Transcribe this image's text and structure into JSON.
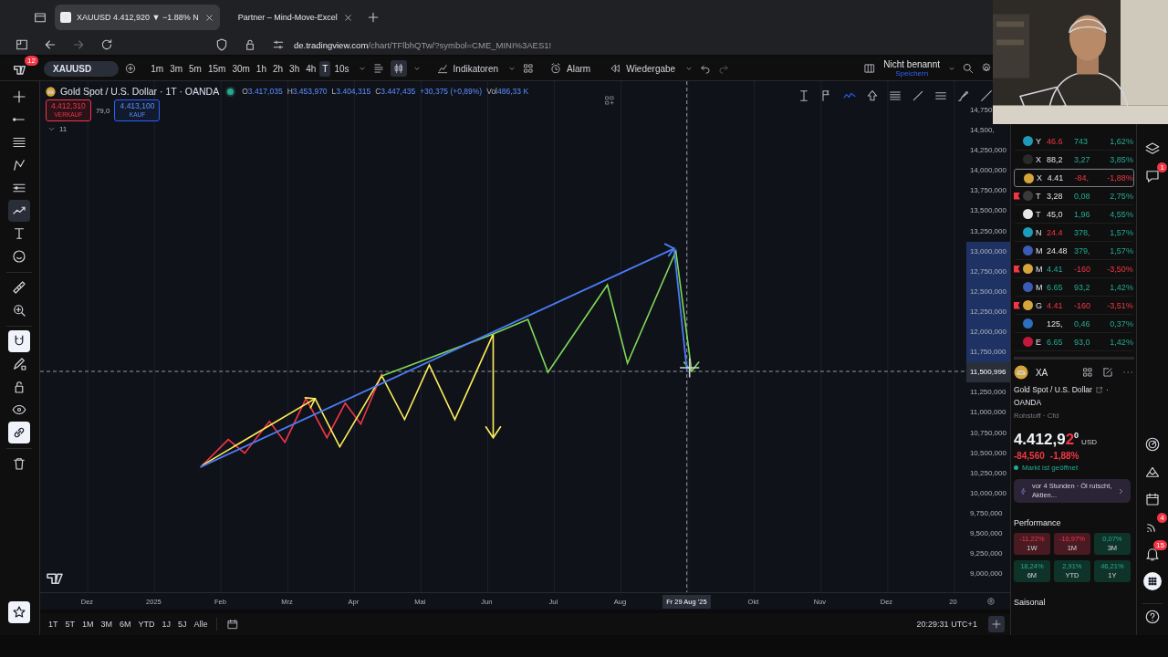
{
  "browser": {
    "tabs": [
      {
        "title": "XAUUSD 4.412,920 ▼ −1.88% N",
        "selected": true
      },
      {
        "title": "Partner – Mind-Move-Excel",
        "selected": false
      }
    ],
    "url_host": "de.tradingview.com",
    "url_path": "/chart/TFlbhQTw/?symbol=CME_MINI%3AES1!"
  },
  "toolbar": {
    "logo_badge": "12",
    "symbol": "XAUUSD",
    "intervals": [
      {
        "label": "1m",
        "selected": false
      },
      {
        "label": "3m",
        "selected": false
      },
      {
        "label": "5m",
        "selected": false
      },
      {
        "label": "15m",
        "selected": false
      },
      {
        "label": "30m",
        "selected": false
      },
      {
        "label": "1h",
        "selected": false
      },
      {
        "label": "2h",
        "selected": false
      },
      {
        "label": "3h",
        "selected": false
      },
      {
        "label": "4h",
        "selected": false
      },
      {
        "label": "T",
        "selected": true
      },
      {
        "label": "10s",
        "selected": false
      }
    ],
    "indicators": "Indikatoren",
    "alarm": "Alarm",
    "replay": "Wiedergabe",
    "layout_name": "Nicht benannt",
    "save": "Speichern"
  },
  "left_tools": [
    {
      "kind": "tool",
      "selected": false
    },
    {
      "kind": "tool",
      "selected": false
    },
    {
      "kind": "tool",
      "selected": false
    },
    {
      "kind": "tool",
      "selected": false
    },
    {
      "kind": "tool",
      "selected": false
    },
    {
      "kind": "tool",
      "selected": true
    },
    {
      "kind": "tool",
      "selected": false
    },
    {
      "kind": "tool",
      "selected": false
    },
    {
      "kind": "tool",
      "selected": false
    },
    {
      "kind": "tool",
      "selected": false
    },
    {
      "kind": "toggle",
      "on": true
    },
    {
      "kind": "toggle",
      "on": false
    },
    {
      "kind": "toggle",
      "on": false
    },
    {
      "kind": "toggle",
      "on": false
    },
    {
      "kind": "toggle",
      "on": true
    },
    {
      "kind": "tool",
      "selected": false
    }
  ],
  "favorites_on": true,
  "legend": {
    "title": "Gold Spot / U.S. Dollar · 1T · OANDA",
    "live": true,
    "ohlc": [
      {
        "label": "O",
        "value": "3.417,035"
      },
      {
        "label": "H",
        "value": "3.453,970"
      },
      {
        "label": "L",
        "value": "3.404,315"
      },
      {
        "label": "C",
        "value": "3.447,435"
      }
    ],
    "change": "+30,375 (+0,89%)",
    "volume_label": "Vol",
    "volume": "486,33 K",
    "sell": {
      "price": "4.412,310",
      "label": "VERKAUF"
    },
    "spread": "79,0",
    "buy": {
      "price": "4.413,100",
      "label": "KAUF"
    },
    "indicator_count": "11"
  },
  "y_axis": [
    {
      "label": "14,750,",
      "in_range": false,
      "current": false
    },
    {
      "label": "14,500,",
      "in_range": false,
      "current": false
    },
    {
      "label": "14,250,000",
      "in_range": false,
      "current": false
    },
    {
      "label": "14,000,000",
      "in_range": false,
      "current": false
    },
    {
      "label": "13,750,000",
      "in_range": false,
      "current": false
    },
    {
      "label": "13,500,000",
      "in_range": false,
      "current": false
    },
    {
      "label": "13,250,000",
      "in_range": false,
      "current": false
    },
    {
      "label": "13,000,000",
      "in_range": true,
      "current": false
    },
    {
      "label": "12,750,000",
      "in_range": true,
      "current": false
    },
    {
      "label": "12,500,000",
      "in_range": true,
      "current": false
    },
    {
      "label": "12,250,000",
      "in_range": true,
      "current": false
    },
    {
      "label": "12,000,000",
      "in_range": true,
      "current": false
    },
    {
      "label": "11,750,000",
      "in_range": true,
      "current": false
    },
    {
      "label": "11,500,996",
      "in_range": false,
      "current": true
    },
    {
      "label": "11,250,000",
      "in_range": false,
      "current": false
    },
    {
      "label": "11,000,000",
      "in_range": false,
      "current": false
    },
    {
      "label": "10,750,000",
      "in_range": false,
      "current": false
    },
    {
      "label": "10,500,000",
      "in_range": false,
      "current": false
    },
    {
      "label": "10,250,000",
      "in_range": false,
      "current": false
    },
    {
      "label": "10,000,000",
      "in_range": false,
      "current": false
    },
    {
      "label": "9,750,000",
      "in_range": false,
      "current": false
    },
    {
      "label": "9,500,000",
      "in_range": false,
      "current": false
    },
    {
      "label": "9,250,000",
      "in_range": false,
      "current": false
    },
    {
      "label": "9,000,000",
      "in_range": false,
      "current": false
    }
  ],
  "x_axis": [
    {
      "label": "Dez",
      "current": false
    },
    {
      "label": "2025",
      "current": false
    },
    {
      "label": "Feb",
      "current": false
    },
    {
      "label": "Mrz",
      "current": false
    },
    {
      "label": "Apr",
      "current": false
    },
    {
      "label": "Mai",
      "current": false
    },
    {
      "label": "Jun",
      "current": false
    },
    {
      "label": "Jul",
      "current": false
    },
    {
      "label": "Aug",
      "current": false
    },
    {
      "label": "Fr 29 Aug '25",
      "current": true
    },
    {
      "label": "Okt",
      "current": false
    },
    {
      "label": "Nov",
      "current": false
    },
    {
      "label": "Dez",
      "current": false
    },
    {
      "label": "20",
      "current": false
    }
  ],
  "ranges": [
    "1T",
    "5T",
    "1M",
    "3M",
    "6M",
    "YTD",
    "1J",
    "5J",
    "Alle"
  ],
  "clock": "20:29:31 UTC+1",
  "watchlist": [
    {
      "symbol": "Y",
      "last": "46.6",
      "last_up": false,
      "last_down": true,
      "change": "743",
      "pct": "1,62%",
      "negative": false,
      "color": "#1e9bb8",
      "flagged": false,
      "selected": false
    },
    {
      "symbol": "X",
      "last": "88,2",
      "last_up": false,
      "last_down": false,
      "change": "3,27",
      "pct": "3,85%",
      "negative": false,
      "color": "#2a2a2a",
      "flagged": false,
      "selected": false
    },
    {
      "symbol": "X",
      "last": "4.41",
      "last_up": false,
      "last_down": false,
      "change": "-84,",
      "pct": "-1,88%",
      "negative": true,
      "color": "#d4a53a",
      "flagged": false,
      "selected": true
    },
    {
      "symbol": "T",
      "last": "3,28",
      "last_up": false,
      "last_down": false,
      "change": "0,08",
      "pct": "2,75%",
      "negative": false,
      "color": "#3a3a3a",
      "flagged": true,
      "selected": false
    },
    {
      "symbol": "T",
      "last": "45,0",
      "last_up": false,
      "last_down": false,
      "change": "1,96",
      "pct": "4,55%",
      "negative": false,
      "color": "#e8e8e8",
      "flagged": false,
      "selected": false
    },
    {
      "symbol": "N",
      "last": "24.4",
      "last_up": false,
      "last_down": true,
      "change": "378,",
      "pct": "1,57%",
      "negative": false,
      "color": "#1e9bb8",
      "flagged": false,
      "selected": false
    },
    {
      "symbol": "M",
      "last": "24.48",
      "last_up": false,
      "last_down": false,
      "change": "379,",
      "pct": "1,57%",
      "negative": false,
      "color": "#3b5bb5",
      "flagged": false,
      "selected": false
    },
    {
      "symbol": "M",
      "last": "4.41",
      "last_up": true,
      "last_down": false,
      "change": "-160",
      "pct": "-3,50%",
      "negative": true,
      "color": "#d4a53a",
      "flagged": true,
      "selected": false
    },
    {
      "symbol": "M",
      "last": "6.65",
      "last_up": true,
      "last_down": false,
      "change": "93,2",
      "pct": "1,42%",
      "negative": false,
      "color": "#3b5bb5",
      "flagged": false,
      "selected": false
    },
    {
      "symbol": "G",
      "last": "4.41",
      "last_up": false,
      "last_down": true,
      "change": "-160",
      "pct": "-3,51%",
      "negative": true,
      "color": "#d4a53a",
      "flagged": true,
      "selected": false
    },
    {
      "last": "125,",
      "last_up": false,
      "last_down": false,
      "change": "0,46",
      "pct": "0,37%",
      "negative": false,
      "color": "#2f6fc0",
      "flagged": false,
      "selected": false
    },
    {
      "symbol": "E",
      "last": "6.65",
      "last_up": true,
      "last_down": false,
      "change": "93,0",
      "pct": "1,42%",
      "negative": false,
      "color": "#c2183a",
      "flagged": false,
      "selected": false
    }
  ],
  "details": {
    "symbol": "XA",
    "name": "Gold Spot / U.S. Dollar",
    "separator": "·",
    "exchange": "OANDA",
    "category": "Rohstoff · Cfd",
    "price_main": "4.412,9",
    "price_last_digit": "2",
    "price_fraction": "0",
    "currency": "USD",
    "change": "-84,560",
    "change_pct": "-1,88%",
    "market_open": true,
    "status": "Markt ist geöffnet",
    "news": "vor 4 Stunden · Öl rutscht, Aktien...",
    "performance_title": "Performance",
    "performance": [
      {
        "value": "-11,22%",
        "period": "1W",
        "negative": true
      },
      {
        "value": "-10,97%",
        "period": "1M",
        "negative": true
      },
      {
        "value": "0,07%",
        "period": "3M",
        "negative": false
      },
      {
        "value": "18,24%",
        "period": "6M",
        "negative": false
      },
      {
        "value": "2,91%",
        "period": "YTD",
        "negative": false
      },
      {
        "value": "46,21%",
        "period": "1Y",
        "negative": false
      }
    ],
    "seasonal_title": "Saisonal"
  },
  "rail": [
    {
      "selected": false
    },
    {
      "selected": false,
      "badge": "1"
    },
    {
      "selected": false
    },
    {
      "selected": false
    },
    {
      "selected": false
    },
    {
      "selected": false,
      "badge": "4"
    },
    {
      "selected": false,
      "badge": "15"
    },
    {
      "selected": true
    },
    {
      "selected": false
    }
  ]
}
